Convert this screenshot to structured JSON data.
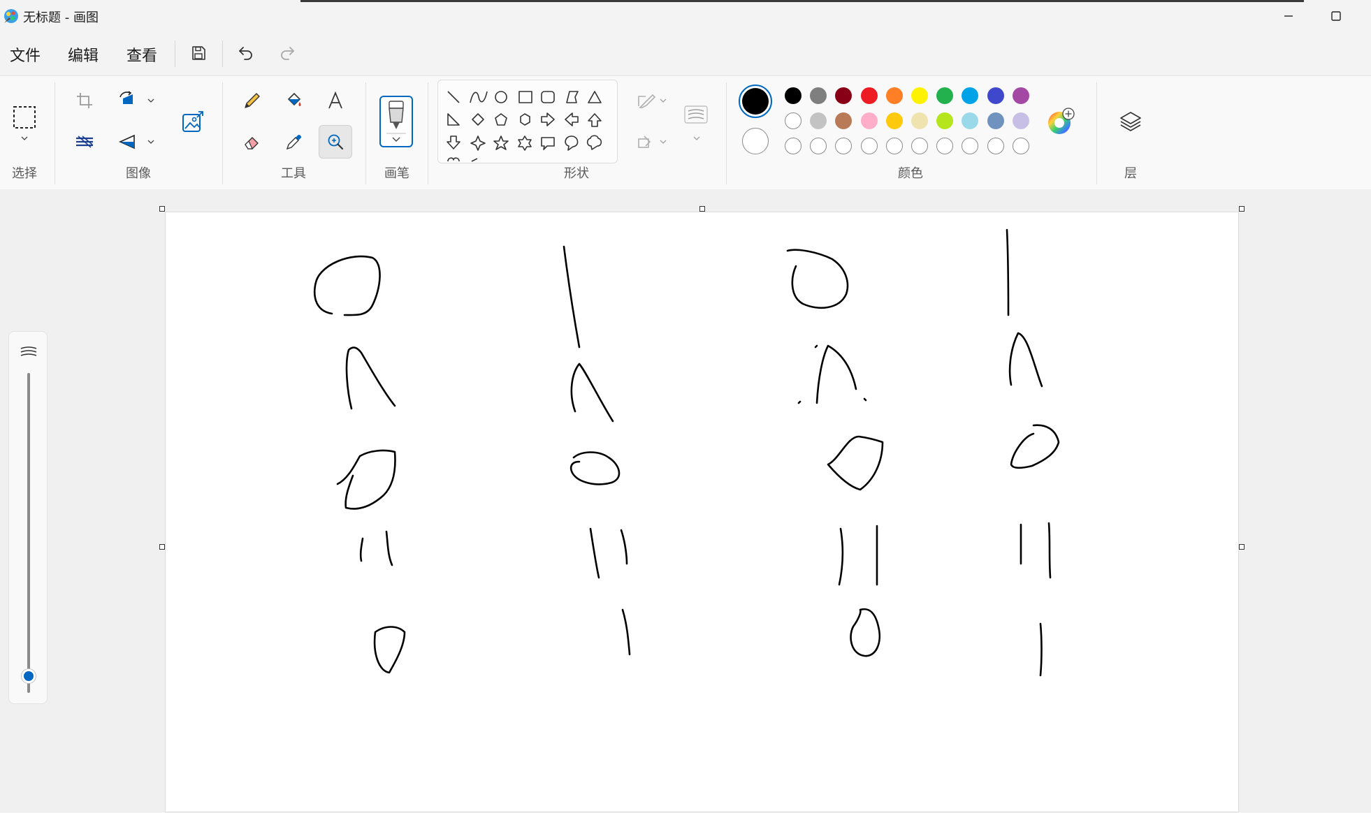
{
  "window": {
    "title": "无标题 - 画图",
    "icons": [
      "paint-app-icon",
      "minimize-icon",
      "maximize-icon"
    ]
  },
  "menu": {
    "file": "文件",
    "edit": "编辑",
    "view": "查看",
    "quick_access_icons": [
      "save-icon",
      "undo-icon",
      "redo-icon"
    ]
  },
  "ribbon": {
    "groups": {
      "select": "选择",
      "image": "图像",
      "tools": "工具",
      "brushes": "画笔",
      "shapes": "形状",
      "colors": "颜色",
      "layers": "层"
    },
    "active_tool": "magnifier",
    "shapes": [
      "line",
      "curve",
      "oval",
      "rectangle",
      "rounded-rectangle",
      "polygon",
      "triangle",
      "right-triangle",
      "diamond",
      "pentagon",
      "hexagon",
      "arrow-right",
      "arrow-left",
      "arrow-up",
      "arrow-down",
      "four-point-star",
      "five-point-star",
      "six-point-star",
      "callout-rect",
      "callout-oval",
      "callout-cloud"
    ]
  },
  "colors": {
    "primary": "#000000",
    "secondary": "#ffffff",
    "accent": "#0067c0",
    "palette_row1": [
      "#000000",
      "#7f7f7f",
      "#880015",
      "#ed1c24",
      "#ff7f27",
      "#fff200",
      "#22b14c",
      "#00a2e8",
      "#3f48cc",
      "#a349a4"
    ],
    "palette_row2": [
      "#ffffff",
      "#c3c3c3",
      "#b97a57",
      "#ffaec9",
      "#ffc90e",
      "#efe4b0",
      "#b5e61d",
      "#99d9ea",
      "#7092be",
      "#c8bfe7"
    ],
    "palette_row3": [
      "",
      "",
      "",
      "",
      "",
      "",
      "",
      "",
      "",
      ""
    ]
  }
}
